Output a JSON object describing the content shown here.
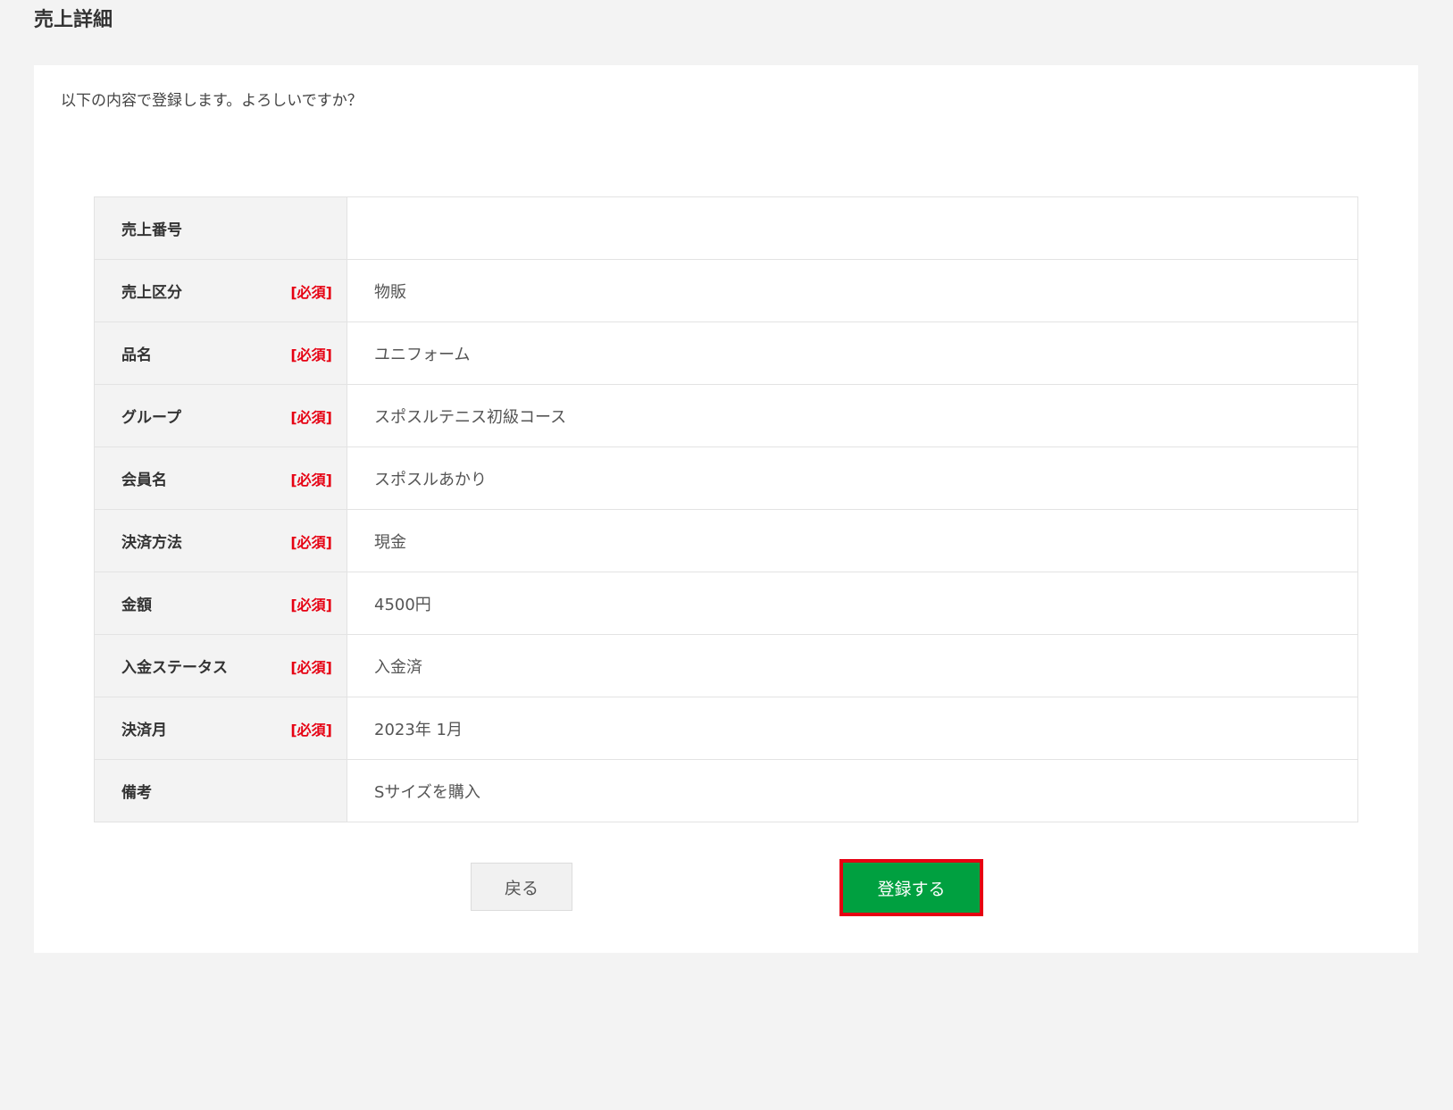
{
  "header": {
    "title": "売上詳細"
  },
  "confirm": {
    "message": "以下の内容で登録します。よろしいですか？"
  },
  "required_label": "[必須]",
  "rows": [
    {
      "label": "売上番号",
      "required": false,
      "value": ""
    },
    {
      "label": "売上区分",
      "required": true,
      "value": "物販"
    },
    {
      "label": "品名",
      "required": true,
      "value": "ユニフォーム"
    },
    {
      "label": "グループ",
      "required": true,
      "value": "スポスルテニス初級コース"
    },
    {
      "label": "会員名",
      "required": true,
      "value": "スポスルあかり"
    },
    {
      "label": "決済方法",
      "required": true,
      "value": "現金"
    },
    {
      "label": "金額",
      "required": true,
      "value": "4500円"
    },
    {
      "label": "入金ステータス",
      "required": true,
      "value": "入金済"
    },
    {
      "label": "決済月",
      "required": true,
      "value": "2023年 1月"
    },
    {
      "label": "備考",
      "required": false,
      "value": "Sサイズを購入"
    }
  ],
  "buttons": {
    "back_label": "戻る",
    "submit_label": "登録する"
  },
  "colors": {
    "required": "#e60012",
    "submit_bg": "#00a040",
    "highlight_border": "#e60012"
  }
}
